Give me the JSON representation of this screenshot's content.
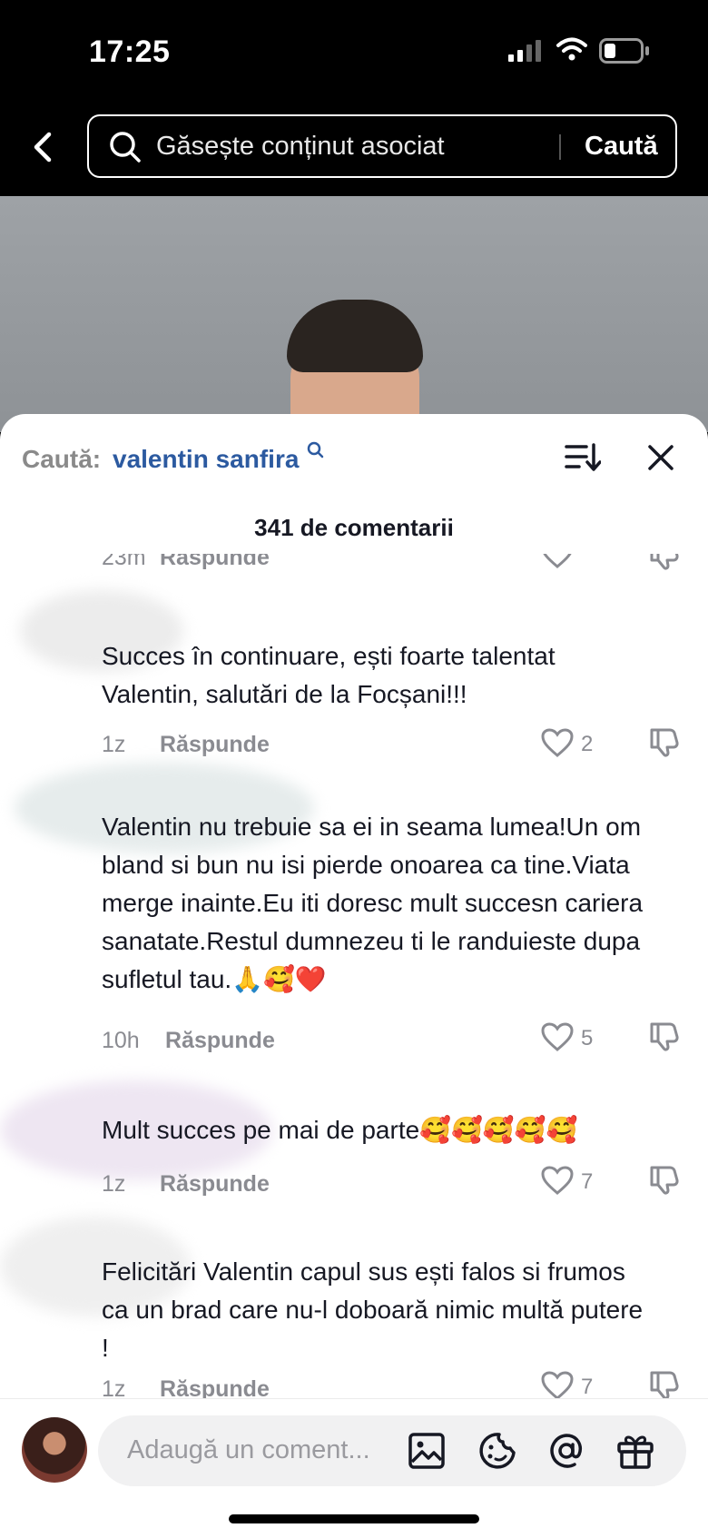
{
  "status_bar": {
    "time": "17:25"
  },
  "search": {
    "placeholder": "Găsește conținut asociat",
    "button": "Caută"
  },
  "comments_sheet": {
    "search_label": "Caută:",
    "search_query": "valentin sanfira",
    "count_label": "341 de comentarii"
  },
  "comments": [
    {
      "text": "",
      "time": "23m",
      "reply": "Răspunde",
      "likes": ""
    },
    {
      "text": "Succes în continuare, ești foarte talentat Valentin, salutări de la Focșani!!!",
      "time": "1z",
      "reply": "Răspunde",
      "likes": "2"
    },
    {
      "text": "Valentin nu trebuie sa ei in seama lumea!Un om bland si bun nu isi pierde onoarea ca tine.Viata merge inainte.Eu iti doresc mult succesn cariera sanatate.Restul dumnezeu ti le randuieste dupa sufletul tau.🙏🥰❤️",
      "time": "10h",
      "reply": "Răspunde",
      "likes": "5"
    },
    {
      "text": "Mult succes pe mai de parte🥰🥰🥰🥰🥰",
      "time": "1z",
      "reply": "Răspunde",
      "likes": "7"
    },
    {
      "text": "Felicitări Valentin capul sus ești falos si frumos ca un brad care nu-l doboară nimic multă putere !",
      "time": "1z",
      "reply": "Răspunde",
      "likes": "7"
    }
  ],
  "composer": {
    "placeholder": "Adaugă un coment..."
  },
  "icons": [
    "back-arrow-icon",
    "search-icon",
    "signal-icon",
    "wifi-icon",
    "battery-icon",
    "sort-icon",
    "close-icon",
    "heart-icon",
    "dislike-icon",
    "image-icon",
    "emoji-icon",
    "mention-icon",
    "gift-icon"
  ]
}
